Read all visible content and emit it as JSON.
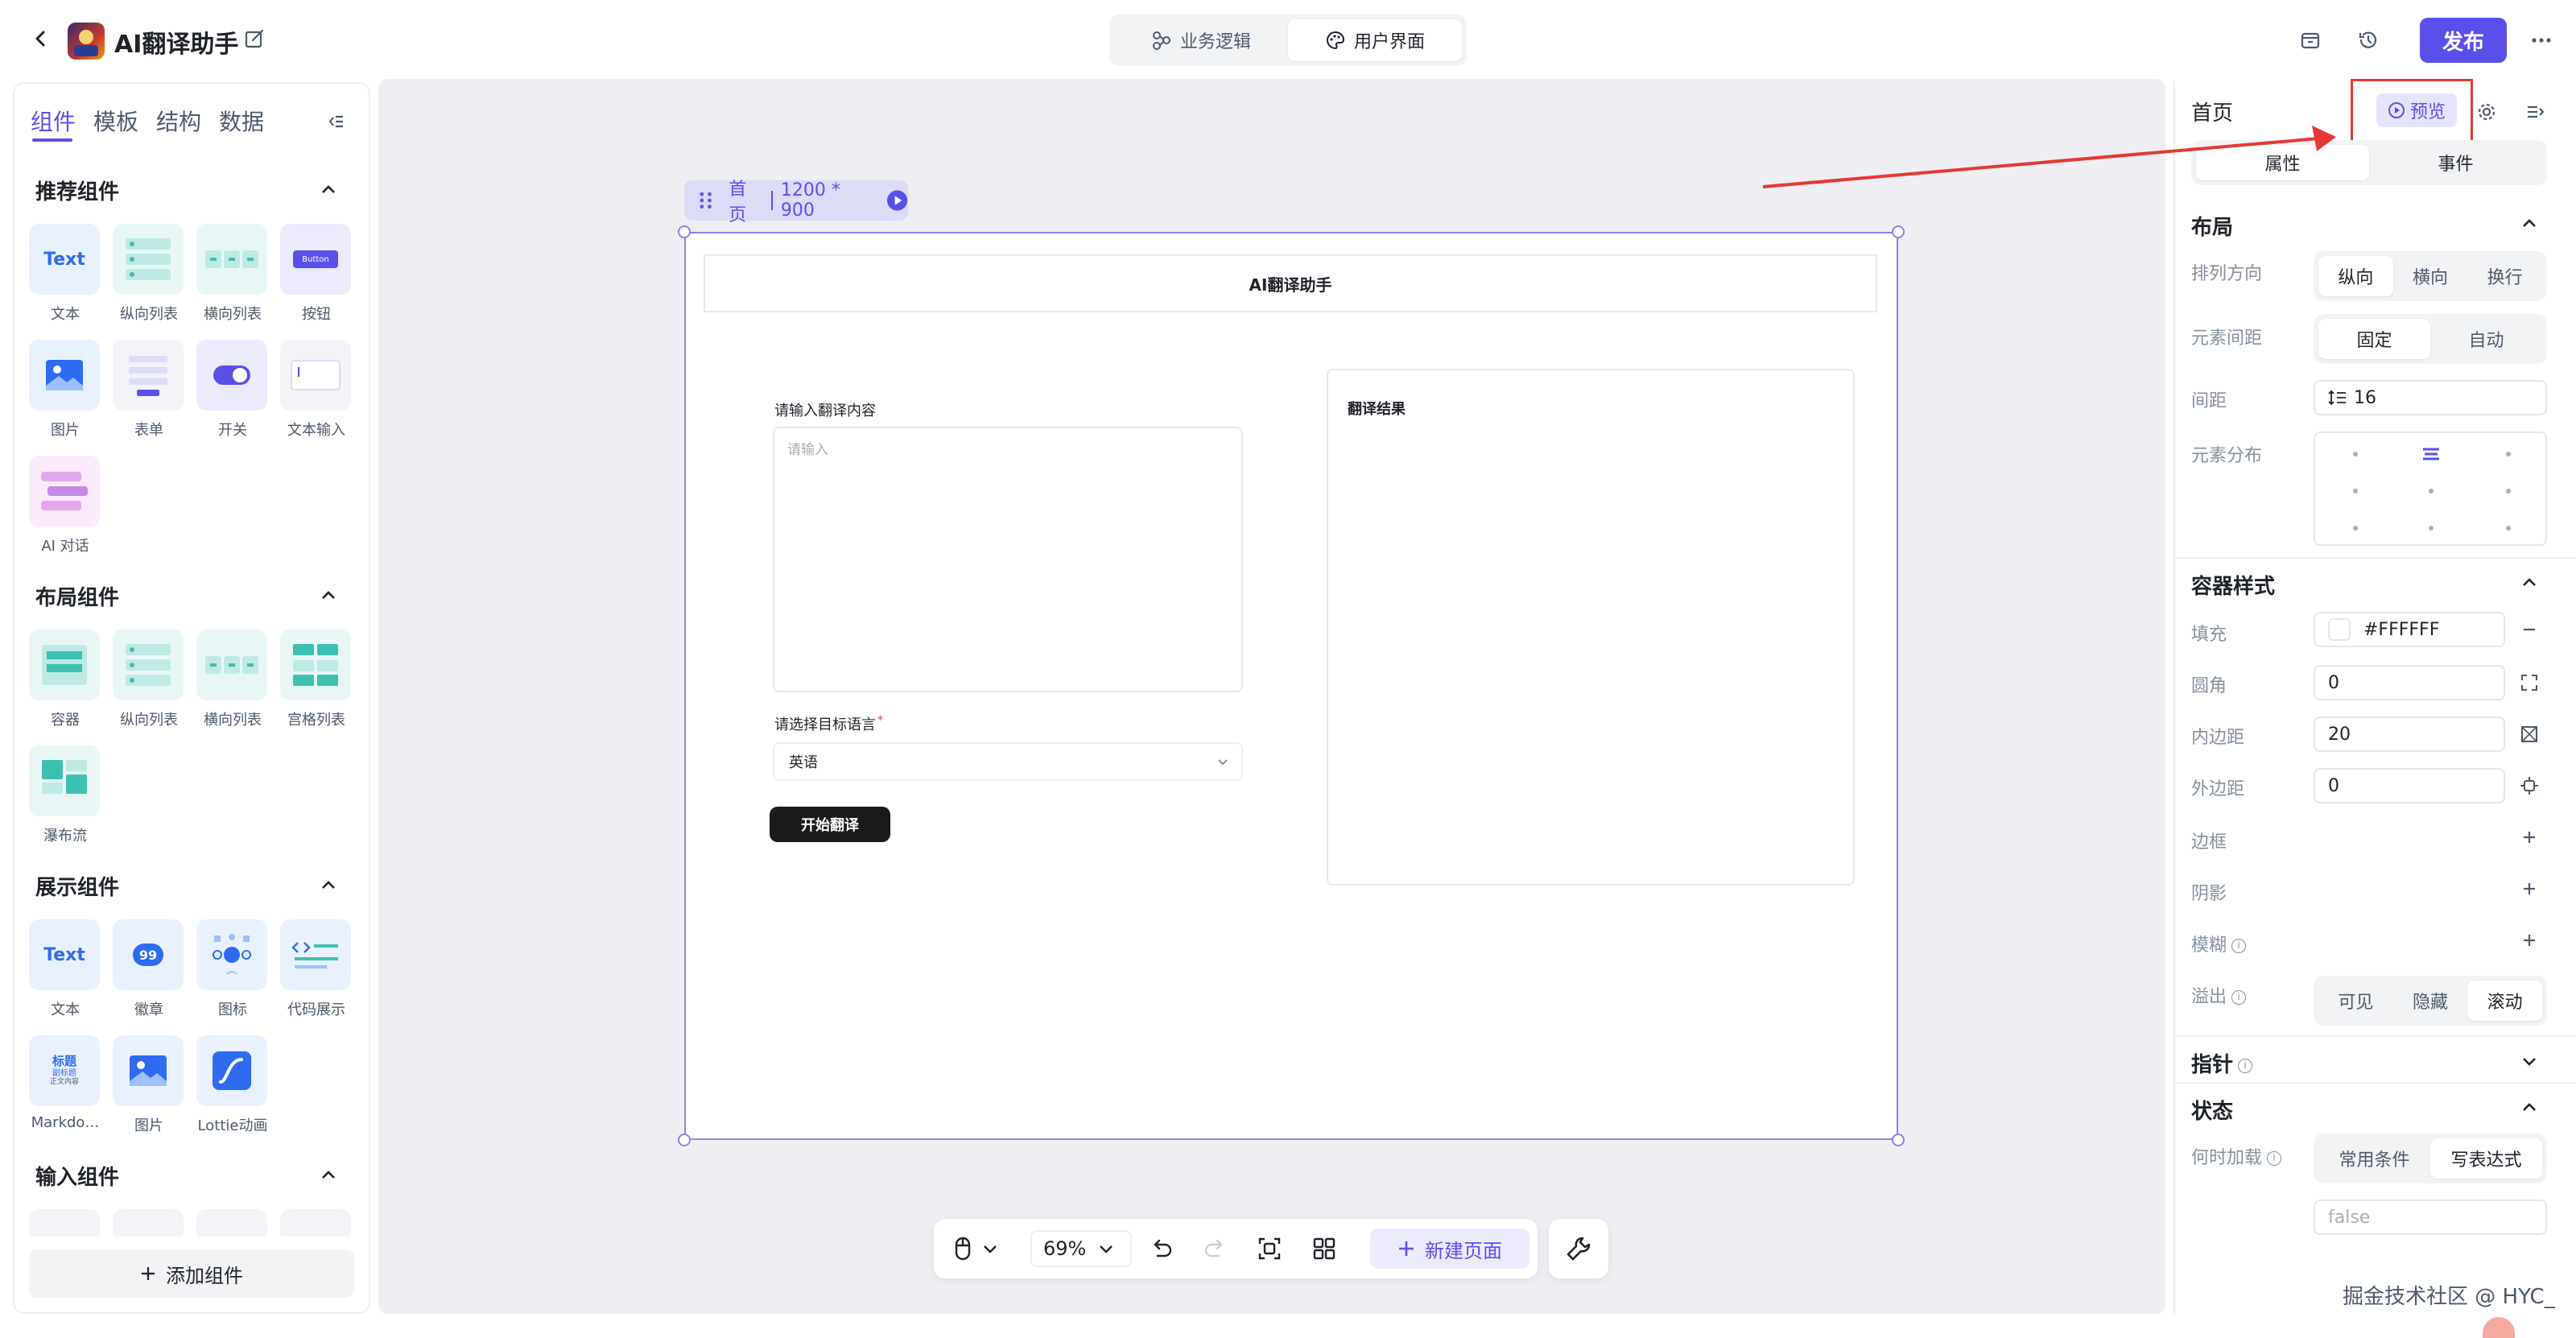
{
  "app": {
    "title": "AI翻译助手"
  },
  "top_tabs": [
    {
      "label": "业务逻辑"
    },
    {
      "label": "用户界面"
    }
  ],
  "publish_label": "发布",
  "left_panel": {
    "tabs": [
      "组件",
      "模板",
      "结构",
      "数据"
    ],
    "groups": [
      {
        "title": "推荐组件",
        "items": [
          "文本",
          "纵向列表",
          "横向列表",
          "按钮",
          "图片",
          "表单",
          "开关",
          "文本输入",
          "AI 对话"
        ]
      },
      {
        "title": "布局组件",
        "items": [
          "容器",
          "纵向列表",
          "横向列表",
          "宫格列表",
          "瀑布流"
        ]
      },
      {
        "title": "展示组件",
        "items": [
          "文本",
          "徽章",
          "图标",
          "代码展示",
          "Markdo…",
          "图片",
          "Lottie动画"
        ]
      },
      {
        "title": "输入组件",
        "items": []
      }
    ],
    "icon_text": {
      "text": "Text",
      "button": "Button",
      "badge": "99",
      "md_title": "标题",
      "md_sub": "副标题",
      "md_body": "正文内容"
    },
    "add_component_label": "添加组件"
  },
  "canvas": {
    "frame_label": "首页",
    "frame_size": "1200 * 900",
    "page_header": "AI翻译助手",
    "input_label": "请输入翻译内容",
    "input_placeholder": "请输入",
    "lang_label": "请选择目标语言",
    "required_mark": "*",
    "lang_value": "英语",
    "translate_button": "开始翻译",
    "result_title": "翻译结果"
  },
  "bottom_toolbar": {
    "zoom": "69%",
    "new_page_label": "新建页面"
  },
  "right_panel": {
    "page_name": "首页",
    "preview_label": "预览",
    "tabs": [
      "属性",
      "事件"
    ],
    "layout": {
      "title": "布局",
      "direction_label": "排列方向",
      "direction_options": [
        "纵向",
        "横向",
        "换行"
      ],
      "spacing_mode_label": "元素间距",
      "spacing_mode_options": [
        "固定",
        "自动"
      ],
      "gap_label": "间距",
      "gap_value": "16",
      "distribution_label": "元素分布"
    },
    "container_style": {
      "title": "容器样式",
      "fill_label": "填充",
      "fill_value": "#FFFFFF",
      "radius_label": "圆角",
      "radius_value": "0",
      "padding_label": "内边距",
      "padding_value": "20",
      "margin_label": "外边距",
      "margin_value": "0",
      "border_label": "边框",
      "shadow_label": "阴影",
      "blur_label": "模糊",
      "overflow_label": "溢出",
      "overflow_options": [
        "可见",
        "隐藏",
        "滚动"
      ]
    },
    "pointer_title": "指针",
    "state": {
      "title": "状态",
      "load_label": "何时加载",
      "load_options": [
        "常用条件",
        "写表达式"
      ],
      "expression_value": "false"
    }
  },
  "watermark": "掘金技术社区 @ HYC_",
  "colors": {
    "accent": "#5b4fe9",
    "annotation_red": "#e53935",
    "teal": "#3cc0b0"
  }
}
